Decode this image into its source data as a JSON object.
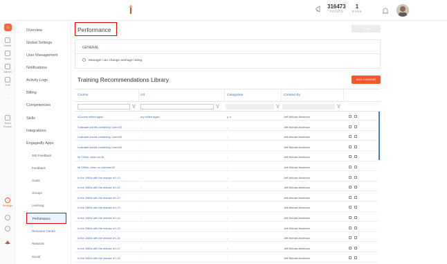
{
  "header": {
    "points_value": "316473",
    "points_label": "POINTS",
    "rank_value": "1",
    "rank_label": "RANK"
  },
  "rail": {
    "items": [
      {
        "label": "Home",
        "icon": "home-icon"
      },
      {
        "label": "Team",
        "icon": "team-icon"
      },
      {
        "label": "Admin",
        "icon": "admin-icon"
      },
      {
        "label": "Drill",
        "icon": "drill-icon"
      },
      {
        "label": "...",
        "icon": "more-icon"
      },
      {
        "label": "Team Evolve",
        "icon": "team-evolve-icon"
      },
      {
        "label": "Settings",
        "icon": "settings-icon"
      }
    ]
  },
  "menu": {
    "items": [
      "Overview",
      "Global Settings",
      "User Management",
      "Notifications",
      "Activity Logs",
      "Billing",
      "Competencies",
      "Skills",
      "Integrations",
      "Engagedly Apps"
    ],
    "subitems": [
      "360 Feedback",
      "Feedback",
      "Goals",
      "Groups",
      "Learning",
      "Performance",
      "Resource Centre",
      "Rewards",
      "Social"
    ]
  },
  "main": {
    "page_title": "Performance",
    "save_label": "SAVE",
    "general_title": "GENERAL",
    "general_option": "Manager can change average rating",
    "library_title": "Training Recommendations Library",
    "add_course_label": "ADD COURSE"
  },
  "table": {
    "columns": [
      "Course",
      "Url",
      "Categories",
      "Created By"
    ],
    "rows": [
      {
        "course": "ACourse edited again",
        "url": "hry edited again",
        "categories": "y, h",
        "created_by": "Jeff Michael Anderson"
      },
      {
        "course": "f ustraaet sheets containing Lorem32",
        "url": "-",
        "categories": "-",
        "created_by": "Jeff Michael Anderson"
      },
      {
        "course": "f ustraaet sheets containing Lorem33",
        "url": "-",
        "categories": "-",
        "created_by": "Jeff Michael Anderson"
      },
      {
        "course": "f ustraaet sheets containing Lorem34",
        "url": "-",
        "categories": "-",
        "created_by": "Jeff Michael Anderson"
      },
      {
        "course": "he 1200s, when an 36",
        "url": "-",
        "categories": "-",
        "created_by": "Jeff Michael Anderson"
      },
      {
        "course": "he 1500s, when an unknown35",
        "url": "-",
        "categories": "-",
        "created_by": "Jeff Michael Anderson"
      },
      {
        "course": "In the 1960s with the release of L10",
        "url": "-",
        "categories": "-",
        "created_by": "Jeff Michael Anderson"
      },
      {
        "course": "In the 1960s with the release of L11",
        "url": "-",
        "categories": "-",
        "created_by": "Jeff Michael Anderson"
      },
      {
        "course": "In the 1960s with the release of L12",
        "url": "-",
        "categories": "-",
        "created_by": "Jeff Michael Anderson"
      },
      {
        "course": "In the 1960s with the release of L13",
        "url": "-",
        "categories": "-",
        "created_by": "Jeff Michael Anderson"
      },
      {
        "course": "In the 1960s with the release of L14",
        "url": "-",
        "categories": "-",
        "created_by": "Jeff Michael Anderson"
      },
      {
        "course": "In the 1960s with the release of L15",
        "url": "-",
        "categories": "-",
        "created_by": "Jeff Michael Anderson"
      },
      {
        "course": "In the 1960s with the release of L16",
        "url": "-",
        "categories": "-",
        "created_by": "Jeff Michael Anderson"
      },
      {
        "course": "In the 1960s with the release of L17",
        "url": "-",
        "categories": "-",
        "created_by": "Jeff Michael Anderson"
      },
      {
        "course": "In the 1960s with the release of L18",
        "url": "-",
        "categories": "-",
        "created_by": "Jeff Michael Anderson"
      }
    ]
  },
  "colors": {
    "accent": "#f05a2a",
    "link": "#3e67b1",
    "highlight_border": "#e00000"
  }
}
